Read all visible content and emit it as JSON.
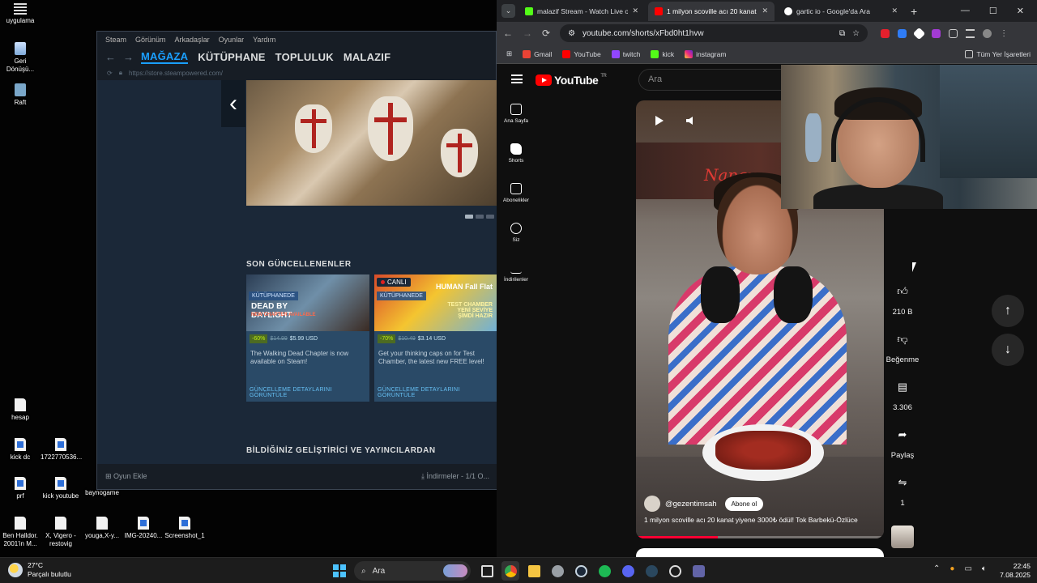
{
  "desktop": {
    "icons": [
      {
        "label": "uygulama"
      },
      {
        "label": "Geri Dönüşü..."
      },
      {
        "label": "Raft"
      },
      {
        "label": "hesap"
      },
      {
        "label": "kick dc"
      },
      {
        "label": "1722770536..."
      },
      {
        "label": "prf"
      },
      {
        "label": "kick youtube"
      },
      {
        "label": "kick baynogame"
      },
      {
        "label": "Ben Halldor. 2001'in M..."
      },
      {
        "label": "X, Vigero - restovig"
      },
      {
        "label": "youga,X-y..."
      },
      {
        "label": "IMG-20240..."
      },
      {
        "label": "Screenshot_1"
      }
    ]
  },
  "steam": {
    "menu": [
      "Steam",
      "Görünüm",
      "Arkadaşlar",
      "Oyunlar",
      "Yardım"
    ],
    "nav_tabs": [
      "MAĞAZA",
      "KÜTÜPHANE",
      "TOPLULUK",
      "MALAZIF"
    ],
    "url": "https://store.steampowered.com/",
    "recent_title": "SON GÜNCELLENENLER",
    "cards": [
      {
        "badge": "KÜTÜPHANEDE",
        "image_title": "DEAD BY DAYLIGHT",
        "image_sub": "NEW CHAPTER AVAILABLE",
        "discount": "-60%",
        "old_price": "$14.99",
        "new_price": "$5.99 USD",
        "desc": "The Walking Dead Chapter is now available on Steam!",
        "details": "GÜNCELLEME DETAYLARINI GÖRÜNTÜLE"
      },
      {
        "live": "CANLI",
        "badge": "KÜTÜPHANEDE",
        "image_title": "HUMAN Fall Flat",
        "image_sub": "TEST CHAMBER YENİ SEVİYE ŞİMDİ HAZIR",
        "discount": "-70%",
        "old_price": "$10.49",
        "new_price": "$3.14 USD",
        "desc": "Get your thinking caps on for Test Chamber, the latest new FREE level!",
        "details": "GÜNCELLEME DETAYLARINI GÖRÜNTÜLE"
      }
    ],
    "dev_title": "BİLDİĞİNİZ GELİŞTİRİCİ VE YAYINCILARDAN",
    "add_game": "Oyun Ekle",
    "downloads": "İndirmeler - 1/1 O..."
  },
  "browser": {
    "tabs": [
      {
        "title": "malazif Stream - Watch Live on",
        "color": "#53fc18"
      },
      {
        "title": "1 milyon scoville acı 20 kanat y",
        "color": "#ff0000"
      },
      {
        "title": "gartic io - Google'da Ara",
        "color": "#ffffff"
      }
    ],
    "url": "youtube.com/shorts/xFbd0ht1hvw",
    "bookmarks": [
      "Gmail",
      "YouTube",
      "twitch",
      "kick",
      "instagram"
    ],
    "all_bookmarks": "Tüm Yer İşaretleri"
  },
  "youtube": {
    "logo": "YouTube",
    "region": "TR",
    "search_placeholder": "Ara",
    "sidebar": [
      "Ana Sayfa",
      "Shorts",
      "Abonelikler",
      "Siz",
      "İndirilenler"
    ],
    "video": {
      "channel": "@gezentimsah",
      "subscribe": "Abone ol",
      "title": "1 milyon scoville acı 20 kanat yiyene 3000₺ ödül! Tok Barbekü-Özlüce",
      "sign_text": "Nancy",
      "progress": 0.33
    },
    "actions": {
      "likes": "210 B",
      "dislike": "Beğenme",
      "comments": "3.306",
      "share": "Paylaş",
      "remix": "1"
    }
  },
  "taskbar": {
    "temperature": "27°C",
    "weather": "Parçalı bulutlu",
    "search": "Ara",
    "time": "22:45",
    "date": "7.08.2025"
  }
}
